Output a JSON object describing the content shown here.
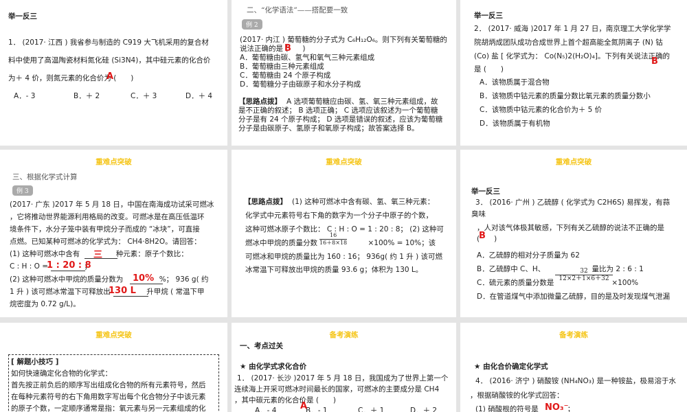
{
  "s1": {
    "title": "举一反三",
    "lines": [
      "1． (2017· 江西 ) 我省参与制造的 C919 大飞机采用的复合材",
      "料中使用了高温陶瓷材料氮化硅 (Si3N4)，其中硅元素的化合价",
      "为＋ 4 价，则氮元素的化合价为 (　　)"
    ],
    "options": [
      "A．- 3",
      "B．＋ 2",
      "C．＋ 3",
      "D．＋ 4"
    ],
    "answer": "A"
  },
  "s2": {
    "section": "二、“化学语法”——搭配要一致",
    "tag": "例 2",
    "lines": [
      "(2017· 内江 ) 葡萄糖的分子式为 C₆H₁₂O₆。则下列有关葡萄糖的",
      "说法正确的是 (　　)",
      "A．葡萄糖由碳、氢气和氧气三种元素组成",
      "B．葡萄糖由三种元素组成",
      "C．葡萄糖由 24 个原子构成",
      "D．葡萄糖分子由碳原子和水分子构成"
    ],
    "hint_label": "【思路点拨】",
    "hint": [
      "A 选项葡萄糖应由碳、氢、氧三种元素组成，故",
      "是不正确的叙述； B 选项正确； C 选项应该叙述为一个葡萄糖",
      "分子是有 24 个原子构成； D 选项是错误的叙述，应该为葡萄糖",
      "分子是由碳原子、氢原子和氧原子构成；故答案选择 B。"
    ],
    "answer": "B"
  },
  "s3": {
    "title": "举一反三",
    "lines": [
      "2． (2017· 威海 )2017 年 1 月 27 日，南京理工大学化学学",
      "院胡炳成团队成功合成世界上首个超高能全氮阴离子 (N) 钴",
      "(Co) 盐 [ 化学式为： Co(N₅)2(H₂O)₄]。下列有关说法正确的",
      "是 (　　)"
    ],
    "options": [
      "A．该物质属于混合物",
      "B．该物质中钴元素的质量分数比氧元素的质量分数小",
      "C．该物质中钴元素的化合价为＋ 5 价",
      "D．该物质属于有机物"
    ],
    "answer": "B"
  },
  "s4": {
    "header": "重难点突破",
    "section": "三、根据化学式计算",
    "tag": "例 3",
    "lines": [
      "(2017· 广东 )2017 年 5 月 18 日，中国在南海成功试采可燃冰",
      "，它将推动世界能源利用格局的改变。可燃冰是在高压低温环",
      "境条件下，水分子笼中装有甲烷分子而成的 “冰块”，可直接",
      "点燃。已知某种可燃冰的化学式为： CH4·8H2O。请回答：",
      "(1) 这种可燃冰中含有　　　　　种元素：原子个数比：",
      "C : H : O =　　　　　；",
      "(2) 这种可燃冰中甲烷的质量分数为　　　　　%； 936 g( 约",
      "1 升 ) 该可燃冰常温下可释放出　　　　　升甲烷 ( 常温下甲",
      "烷密度为 0.72 g/L)。"
    ],
    "answers": [
      "三",
      "1 : 20 : 8",
      "10%",
      "130 L"
    ]
  },
  "s5": {
    "header": "重难点突破",
    "hint_label": "【思路点拨】",
    "lines": [
      "(1) 这种可燃冰中含有碳、氢、氧三种元素：",
      "化学式中元素符号右下角的数字为一个分子中原子的个数，",
      "这种可燃冰原子个数比： C : H : O = 1 : 20 : 8； (2) 这种可",
      "燃冰中甲烷的质量分数　　　　　　　×100% = 10%；该",
      "可燃冰和甲烷的质量比为 160 : 16； 936g( 约 1 升 ) 该可燃",
      "冰常温下可释放出甲烷的质量 93.6 g；体积为 130 L。"
    ],
    "frac_num": "16",
    "frac_den": "16＋8×18"
  },
  "s6": {
    "header": "重难点突破",
    "title": "举一反三",
    "lines": [
      "3． (2016· 广州 ) 乙硫醇 ( 化学式为 C2H6S) 易挥发，有蒜",
      "臭味",
      "，人对该气体极其敏感，下列有关乙硫醇的说法不正确的是",
      "(　　)",
      "A．乙硫醇的相对分子质量为 62",
      "B．乙硫醇中 C、H、　　　　　　　量比为 2 : 6 : 1",
      "C．硫元素的质量分数是　　　　　　　　×100%",
      "D．在管道煤气中添加微量乙硫醇，目的是及时发现煤气泄漏"
    ],
    "frac_num": "32",
    "frac_den": "12×2＋1×6＋32",
    "answer": "B"
  },
  "s7": {
    "header": "重难点突破",
    "box_title": "[ 解题小技巧 ]",
    "lines": [
      "如何快速确定化合物的化学式：",
      "首先按正前负后的顺序写出组成化合物的所有元素符号，然后",
      "在每种元素符号的右下角用数字写出每个化合物分子中该元素",
      "的原子个数，一定顺序通常是指：氧元素与另一元素组成的化"
    ]
  },
  "s8": {
    "header": "备考演练",
    "section": "一、考点过关",
    "subsection": "★ 由化学式求化合价",
    "lines": [
      "1． (2017· 长沙 )2017 年 5 月 18 日，我国成为了世界上第一个",
      "连续海上开采可燃冰时间最长的国家，可燃冰的主要成分是 CH4",
      "，其中碳元素的化合价是 (　　)"
    ],
    "options": [
      "A．- 4",
      "B．- 1",
      "C．＋ 1",
      "D．＋ 2"
    ],
    "answer": "A"
  },
  "s9": {
    "header": "备考演练",
    "subsection": "★ 由化合价确定化学式",
    "lines": [
      "4． (2016· 济宁 ) 硝酸铵 (NH₄NO₃) 是一种铵盐，极易溶于水",
      "，根据硝酸铵的化学式回答：",
      "(1) 硝酸根的符号是　　　　；"
    ],
    "answer": "NO₃⁻"
  },
  "colors": {
    "header": "#f5c518",
    "answer": "#e01818",
    "background": "#e4e4e4"
  }
}
